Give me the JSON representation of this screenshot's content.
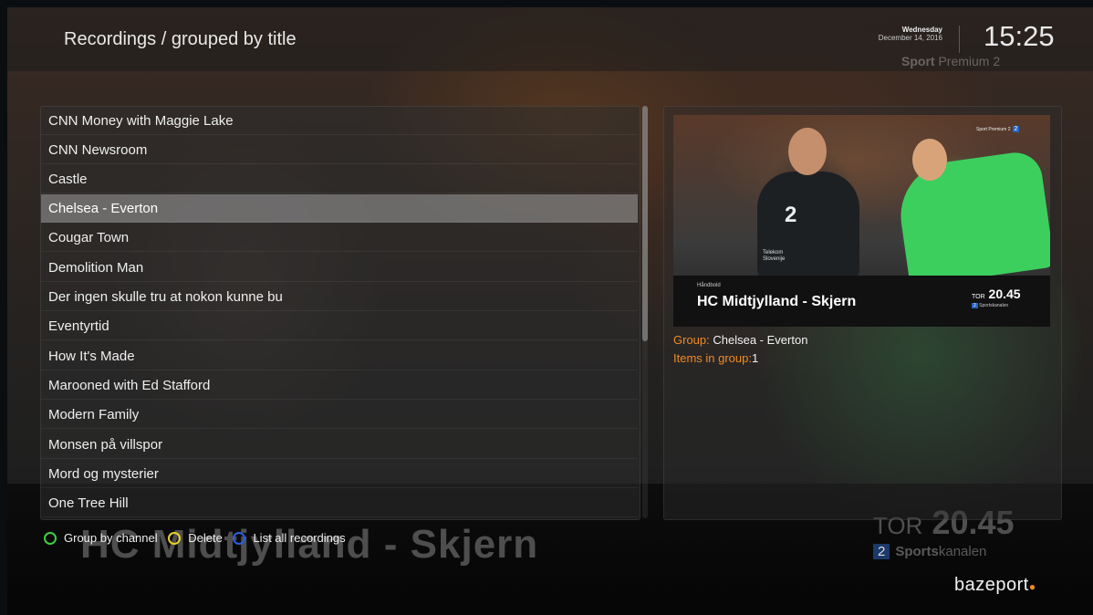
{
  "header": {
    "title": "Recordings / grouped by title",
    "day": "Wednesday",
    "date": "December 14, 2016",
    "time": "15:25",
    "channel_bold": "Sport",
    "channel_rest": " Premium 2"
  },
  "list": {
    "selected_index": 3,
    "items": [
      "CNN Money with Maggie Lake",
      "CNN Newsroom",
      "Castle",
      "Chelsea - Everton",
      "Cougar Town",
      "Demolition Man",
      "Der ingen skulle tru at nokon kunne bu",
      "Eventyrtid",
      "How It's Made",
      "Marooned with Ed Stafford",
      "Modern Family",
      "Monsen på villspor",
      "Mord og mysterier",
      "One Tree Hill"
    ]
  },
  "details": {
    "thumbnail": {
      "sport": "Håndbold",
      "title": "HC Midtjylland - Skjern",
      "tor": "TOR",
      "time": "20.45",
      "channel_num": "2",
      "channel_name": "Sportskanalen",
      "logo_text": "Sport Premium 2",
      "logo_num": "2",
      "jersey": "2",
      "sponsor_line1": "Telekom",
      "sponsor_line2": "Slovenije"
    },
    "group_label": "Group:",
    "group_value": "Chelsea - Everton",
    "items_label": "Items in group:",
    "items_value": "1"
  },
  "background": {
    "title": "HC Midtjylland - Skjern",
    "tor": "TOR",
    "time": "20.45",
    "channel_num": "2",
    "channel_bold": "Sports",
    "channel_rest": "kanalen"
  },
  "hints": [
    {
      "label": "Group by channel",
      "color": "#3fcf3f"
    },
    {
      "label": "Delete",
      "color": "#e6d22a"
    },
    {
      "label": "List all recordings",
      "color": "#2a5fe0"
    }
  ],
  "brand": {
    "name": "bazeport",
    "dot": "●"
  }
}
